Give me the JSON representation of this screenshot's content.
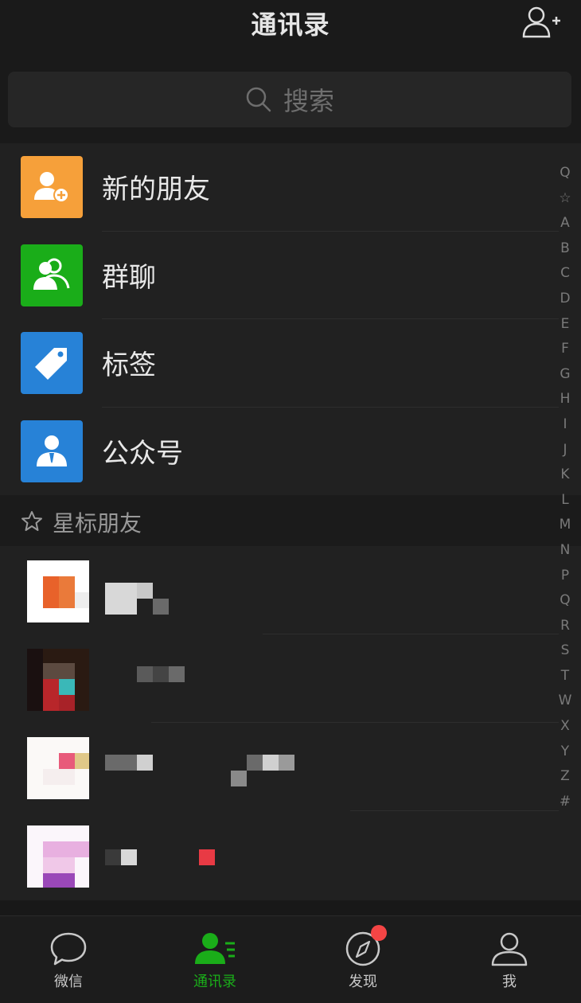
{
  "header": {
    "title": "通讯录",
    "add_icon": "add-friend-icon"
  },
  "search": {
    "placeholder": "搜索",
    "icon": "search-icon"
  },
  "functions": [
    {
      "label": "新的朋友",
      "color": "#f6a03a",
      "icon": "new-friend-icon"
    },
    {
      "label": "群聊",
      "color": "#1aad19",
      "icon": "group-chat-icon"
    },
    {
      "label": "标签",
      "color": "#2782d7",
      "icon": "tag-icon"
    },
    {
      "label": "公众号",
      "color": "#2782d7",
      "icon": "official-account-icon"
    }
  ],
  "starred_section": {
    "label": "星标朋友",
    "icon": "star-icon"
  },
  "index_letters": [
    "Q",
    "☆",
    "A",
    "B",
    "C",
    "D",
    "E",
    "F",
    "G",
    "H",
    "I",
    "J",
    "K",
    "L",
    "M",
    "N",
    "P",
    "Q",
    "R",
    "S",
    "T",
    "W",
    "X",
    "Y",
    "Z",
    "#"
  ],
  "tabs": [
    {
      "label": "微信",
      "icon": "chat-bubble-icon",
      "active": false
    },
    {
      "label": "通讯录",
      "icon": "contacts-icon",
      "active": true
    },
    {
      "label": "发现",
      "icon": "compass-icon",
      "active": false,
      "badge": true
    },
    {
      "label": "我",
      "icon": "profile-icon",
      "active": false
    }
  ],
  "colors": {
    "accent": "#1aad19",
    "badge": "#f44545",
    "background": "#212121"
  }
}
